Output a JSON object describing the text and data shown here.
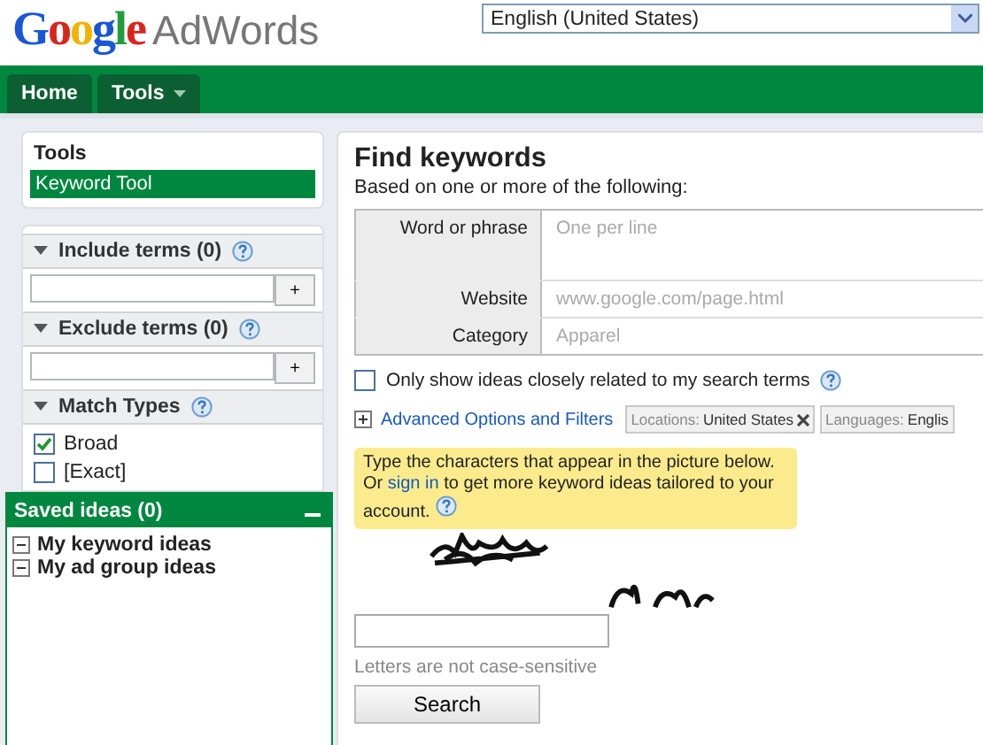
{
  "header": {
    "logo": {
      "brand": "Google",
      "product": "AdWords"
    },
    "language_select": {
      "value": "English (United States)"
    }
  },
  "nav": [
    {
      "label": "Home",
      "kind": "tab"
    },
    {
      "label": "Tools",
      "kind": "menu"
    }
  ],
  "sidebar": {
    "tools": {
      "title": "Tools",
      "items": [
        {
          "label": "Keyword Tool",
          "selected": true
        }
      ]
    },
    "filters": [
      {
        "kind": "terms",
        "title": "Include terms (0)",
        "expanded": true,
        "add_button": "+"
      },
      {
        "kind": "terms",
        "title": "Exclude terms (0)",
        "expanded": true,
        "add_button": "+"
      },
      {
        "kind": "options",
        "title": "Match Types",
        "expanded": true,
        "options": [
          {
            "label": "Broad",
            "checked": true
          },
          {
            "label": "[Exact]",
            "checked": false
          }
        ]
      }
    ],
    "saved_ideas": {
      "title": "Saved ideas (0)",
      "items": [
        {
          "label": "My keyword ideas",
          "expanded": true
        },
        {
          "label": "My ad group ideas",
          "expanded": true
        }
      ]
    }
  },
  "main": {
    "title": "Find keywords",
    "subtitle": "Based on one or more of the following:",
    "fields": [
      {
        "kind": "multiline",
        "label": "Word or phrase",
        "placeholder": "One per line"
      },
      {
        "kind": "text",
        "label": "Website",
        "placeholder": "www.google.com/page.html"
      },
      {
        "kind": "text",
        "label": "Category",
        "placeholder": "Apparel"
      }
    ],
    "closely_related": {
      "label": "Only show ideas closely related to my search terms",
      "checked": false
    },
    "advanced": {
      "label": "Advanced Options and Filters",
      "expanded": false
    },
    "chips": [
      {
        "name": "Locations:",
        "value": "United States",
        "removable": true
      },
      {
        "name": "Languages:",
        "value": "Englis",
        "removable": false
      }
    ],
    "captcha": {
      "notice_before": "Type the characters that appear in the picture below. Or",
      "link": "sign in",
      "notice_after": "to get more keyword ideas tailored to your account.",
      "hint": "Letters are not case-sensitive",
      "button": "Search"
    }
  }
}
